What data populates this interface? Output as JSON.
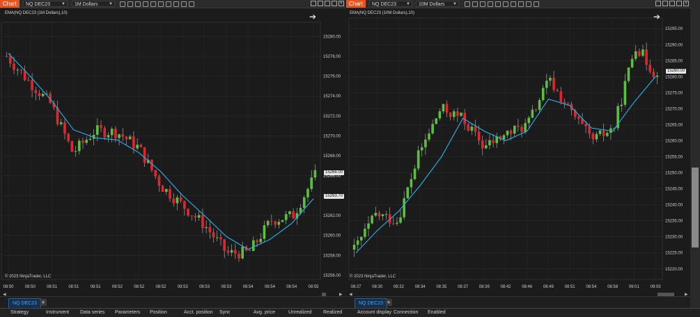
{
  "left_panel": {
    "chart_button": "Chart",
    "instrument": "NQ DEC23",
    "series": "1M Dollars",
    "indicator_label": "EMA(NQ DEC23 (1M Dollars),10)",
    "copyright": "© 2023 NinjaTrader, LLC",
    "tab": "NQ DEC23",
    "y_ticks": [
      "15280.00",
      "15278.00",
      "15276.00",
      "15274.00",
      "15272.00",
      "15270.00",
      "15268.00",
      "15266.00",
      "15264.00",
      "15262.00",
      "15260.00",
      "15258.00",
      "15256.00"
    ],
    "x_ticks": [
      "08:50",
      "08:50",
      "08:51",
      "08:51",
      "08:51",
      "08:52",
      "08:52",
      "08:52",
      "08:53",
      "08:53",
      "08:53",
      "08:54",
      "08:54",
      "08:54",
      "08:55"
    ],
    "price_tags": [
      "15266.00",
      "15263.70"
    ]
  },
  "right_panel": {
    "chart_button": "Chart",
    "instrument": "NQ DEC23",
    "series": "10M Dollars",
    "indicator_label": "EMA(NQ DEC23 (10M Dollars),10)",
    "copyright": "© 2023 NinjaTrader, LLC",
    "tab": "NQ DEC23",
    "y_ticks": [
      "15295.00",
      "15290.00",
      "15285.00",
      "15280.00",
      "15275.00",
      "15270.00",
      "15265.00",
      "15260.00",
      "15255.00",
      "15250.00",
      "15245.00",
      "15240.00",
      "15235.00",
      "15230.00",
      "15225.00",
      "15220.00"
    ],
    "x_ticks": [
      "08:27",
      "08:30",
      "08:32",
      "08:34",
      "08:35",
      "08:37",
      "08:39",
      "08:42",
      "08:46",
      "08:49",
      "08:51",
      "08:54",
      "08:58",
      "09:01",
      "09:03"
    ],
    "price_tag": "15280.00"
  },
  "strategies_grid": {
    "columns": [
      "Strategy",
      "Instrument",
      "Data series",
      "Parameters",
      "Position",
      "Acct. position",
      "Sync",
      "Avg. price",
      "Unrealized",
      "Realized",
      "Account display",
      "Connection",
      "Enabled"
    ]
  },
  "colors": {
    "up": "#5cc03f",
    "down": "#e0262c",
    "ema": "#2aa8e0",
    "accent": "#e8541e"
  },
  "chart_data": [
    {
      "type": "candlestick",
      "title": "EMA(NQ DEC23 (1M Dollars),10)",
      "ylim": [
        15256,
        15281
      ],
      "x": [
        "08:50",
        "08:50",
        "08:51",
        "08:51",
        "08:51",
        "08:52",
        "08:52",
        "08:52",
        "08:53",
        "08:53",
        "08:53",
        "08:54",
        "08:54",
        "08:54",
        "08:55"
      ],
      "series": [
        {
          "name": "EMA(NQ DEC23 (1M Dollars),10)",
          "values": [
            15278.3,
            15276.0,
            15273.5,
            15270.6,
            15269.8,
            15269.6,
            15268.3,
            15266.4,
            15264.0,
            15262.0,
            15259.9,
            15258.6,
            15259.6,
            15261.2,
            15263.7
          ]
        }
      ],
      "close_values": [
        15278.0,
        15275.5,
        15273.2,
        15268.3,
        15270.5,
        15270.4,
        15268.8,
        15265.0,
        15263.0,
        15261.0,
        15258.2,
        15258.3,
        15261.5,
        15262.0,
        15266.0
      ],
      "last_price": 15266.0
    },
    {
      "type": "candlestick",
      "title": "EMA(NQ DEC23 (10M Dollars),10)",
      "ylim": [
        15218,
        15297
      ],
      "x": [
        "08:27",
        "08:30",
        "08:32",
        "08:34",
        "08:35",
        "08:37",
        "08:39",
        "08:42",
        "08:46",
        "08:49",
        "08:51",
        "08:54",
        "08:58",
        "09:01",
        "09:03"
      ],
      "series": [
        {
          "name": "EMA(NQ DEC23 (10M Dollars),10)",
          "values": [
            15225.0,
            15232.0,
            15238.0,
            15246.0,
            15255.0,
            15267.0,
            15263.0,
            15260.0,
            15263.0,
            15273.0,
            15271.0,
            15264.0,
            15263.0,
            15272.0,
            15280.0
          ]
        }
      ],
      "close_values": [
        15226.0,
        15237.0,
        15235.0,
        15256.0,
        15270.0,
        15267.0,
        15258.0,
        15262.0,
        15265.0,
        15279.0,
        15269.0,
        15260.0,
        15264.0,
        15290.0,
        15280.0
      ],
      "last_price": 15280.0
    }
  ]
}
